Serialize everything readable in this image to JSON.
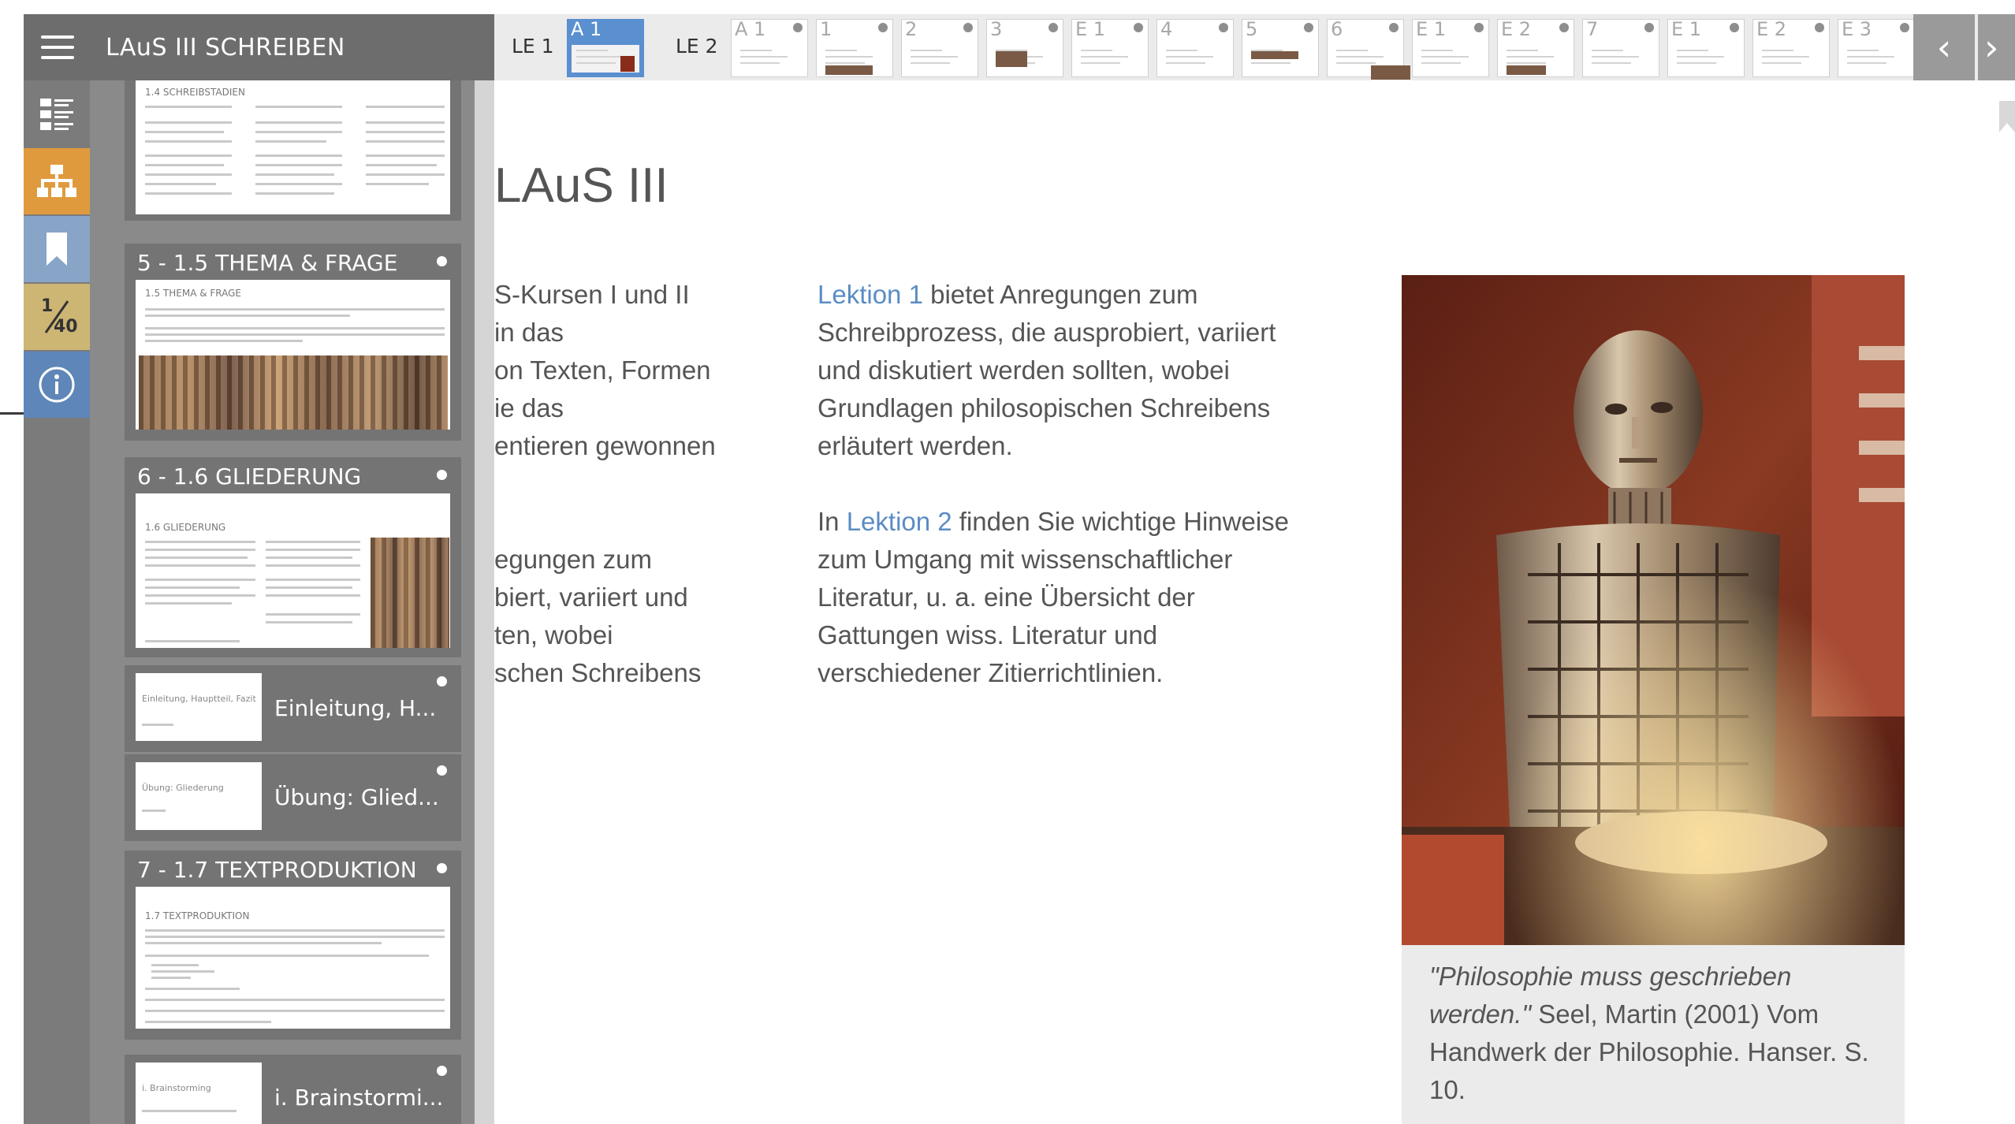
{
  "app": {
    "title": "LAuS III SCHREIBEN"
  },
  "icons": {
    "menu": "menu-icon",
    "toc": "table-of-contents-icon",
    "structure": "sitemap-icon",
    "bookmark": "bookmark-icon",
    "page_counter": {
      "current": "1",
      "total": "40"
    },
    "info": "info-icon"
  },
  "toolbar": {
    "groups": [
      {
        "label": "LE 1",
        "tabs": [
          "A 1"
        ]
      },
      {
        "label": "LE 2",
        "tabs": [
          "A 1",
          "1",
          "2",
          "3",
          "E 1",
          "4",
          "5",
          "6",
          "E 1",
          "E 2",
          "7",
          "E 1",
          "E 2",
          "E 3"
        ]
      }
    ],
    "active_tab": "A 1",
    "prev": "‹",
    "next": "›"
  },
  "sidebar": {
    "cards": [
      {
        "title": "",
        "mini_heading": "1.4 SCHREIBSTADIEN"
      },
      {
        "title": "5 - 1.5 THEMA & FRAGE",
        "mini_heading": "1.5 THEMA & FRAGE"
      },
      {
        "title": "6 - 1.6 GLIEDERUNG",
        "mini_heading": "1.6 GLIEDERUNG"
      },
      {
        "title": "7 - 1.7 TEXTPRODUKTION",
        "mini_heading": "1.7 TEXTPRODUKTION"
      }
    ],
    "sub_items": [
      {
        "label": "Einleitung, H...",
        "mini_heading": "Einleitung, Hauptteil, Fazit"
      },
      {
        "label": "Übung: Glied...",
        "mini_heading": "Übung: Gliederung"
      },
      {
        "label": "i. Brainstormi...",
        "mini_heading": "i. Brainstorming"
      }
    ]
  },
  "main": {
    "heading": "LAuS III",
    "left_column_lines": [
      "S-Kursen I und II",
      "in das",
      "on Texten, Formen",
      "ie das",
      "entieren gewonnen",
      "",
      "",
      "egungen zum",
      "biert, variiert und",
      "ten, wobei",
      "schen Schreibens"
    ],
    "para1": {
      "link": "Lektion 1",
      "text": " bietet Anregungen zum Schreibprozess, die ausprobiert, variiert und diskutiert werden sollten, wobei Grundlagen philosopischen Schreibens erläutert werden."
    },
    "para2": {
      "prefix": "In ",
      "link": "Lektion 2",
      "text": " finden Sie wichtige Hinweise zum Umgang mit wissenschaftlicher Literatur, u. a. eine Übersicht der Gattungen wiss. Literatur und verschiedener Zitierrichtlinien."
    },
    "image": {
      "description": "robot-image"
    },
    "caption": {
      "quote": "\"Philosophie muss geschrieben werden.\"",
      "source": " Seel, Martin (2001) Vom Handwerk der Philosophie. Hanser. S. 10."
    }
  },
  "colors": {
    "header_gray": "#6d6d6d",
    "structure_orange": "#e09a3e",
    "bookmark_blue": "#88a4c6",
    "page_tan": "#cdb574",
    "info_blue": "#5e86b8",
    "link_blue": "#5a8cc4",
    "active_tab_blue": "#5a8fd0"
  }
}
